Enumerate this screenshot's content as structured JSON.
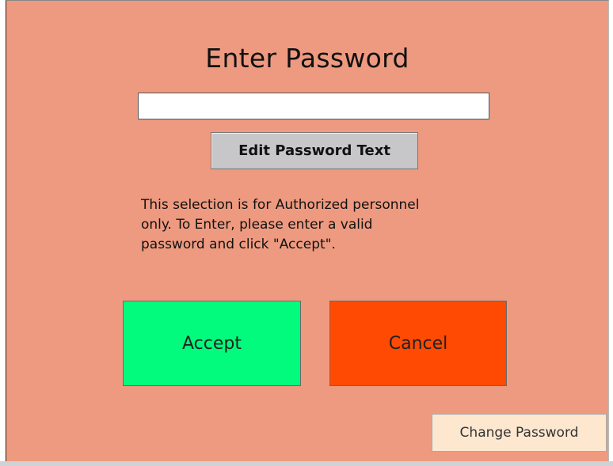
{
  "dialog": {
    "title": "Enter Password",
    "password_value": "",
    "edit_button_label": "Edit Password Text",
    "info_text": "This selection is for Authorized personnel\nonly.   To Enter, please enter a valid\npassword and click \"Accept\".",
    "accept_label": "Accept",
    "cancel_label": "Cancel",
    "change_password_label": "Change Password"
  },
  "colors": {
    "background": "#ee9a80",
    "accept": "#02fb7c",
    "cancel": "#ff4a03",
    "change_password": "#fde7cf",
    "edit_button": "#c7c7c9"
  }
}
